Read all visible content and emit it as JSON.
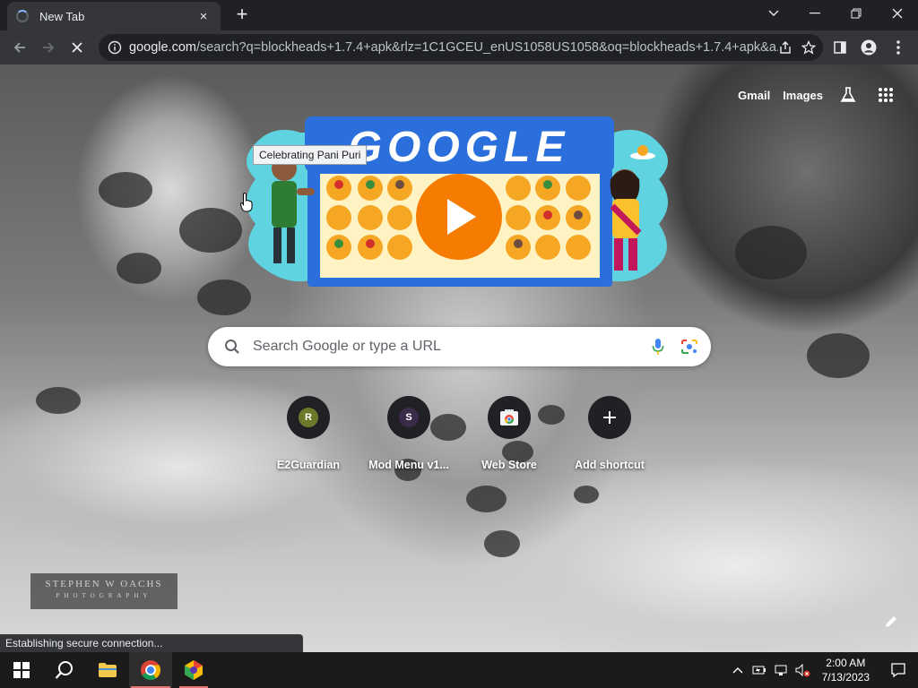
{
  "browser": {
    "tab": {
      "title": "New Tab",
      "close_icon": "×"
    },
    "new_tab_icon": "+",
    "window_controls": {
      "dropdown": "⌄",
      "minimize": "—",
      "restore": "❐",
      "close": "✕"
    },
    "address_bar": {
      "domain": "google.com",
      "path": "/search?q=blockheads+1.7.4+apk&rlz=1C1GCEU_enUS1058US1058&oq=blockheads+1.7.4+apk&a..."
    }
  },
  "ntp": {
    "top_links": {
      "gmail": "Gmail",
      "images": "Images"
    },
    "doodle": {
      "logo_text": "GOOGLE",
      "tooltip": "Celebrating Pani Puri"
    },
    "search": {
      "placeholder": "Search Google or type a URL"
    },
    "shortcuts": [
      {
        "label": "E2Guardian",
        "letter": "R",
        "color": "#6b7a2a"
      },
      {
        "label": "Mod Menu v1...",
        "letter": "S",
        "color": "#3c2a4a"
      },
      {
        "label": "Web Store",
        "icon": "web-store-icon"
      },
      {
        "label": "Add shortcut",
        "icon": "plus-icon",
        "glyph": "+"
      }
    ],
    "watermark": {
      "line1": "STEPHEN W OACHS",
      "line2": "PHOTOGRAPHY"
    }
  },
  "status_bubble": "Establishing secure connection...",
  "taskbar": {
    "clock": {
      "time": "2:00 AM",
      "date": "7/13/2023"
    }
  },
  "colors": {
    "chrome_dark": "#202124",
    "toolbar": "#35363a",
    "doodle_blue": "#2a6fdb",
    "doodle_orange": "#f57c00",
    "doodle_teal": "#5fd3e0"
  }
}
